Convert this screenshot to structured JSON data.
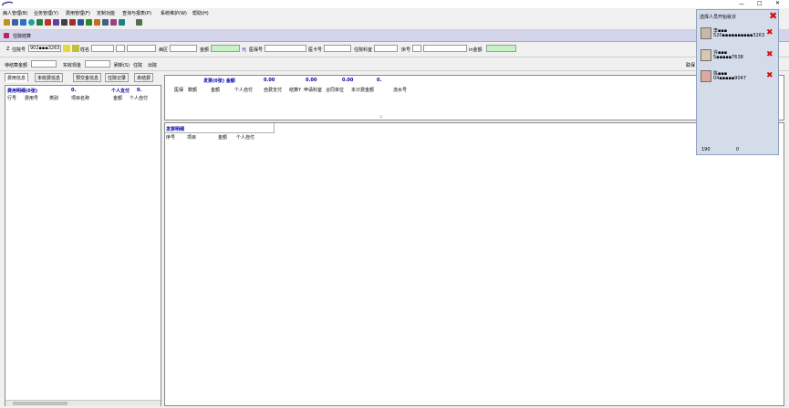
{
  "window": {
    "title": "住院结算",
    "controls": [
      "—",
      "□",
      "✕"
    ]
  },
  "menu": [
    "病人管理(B)",
    "业务管理(Y)",
    "费用管理(F)",
    "定制功能",
    "查询与报表(P)",
    "系统维护(W)",
    "帮助(H)"
  ],
  "form": {
    "admission_no_label": "住院号",
    "admission_no_value": "902▪▪▪3263",
    "name_label": "姓名",
    "bed_label": "病区",
    "amount_label": "金额",
    "unit_label": "元",
    "medical_no_label": "医保号",
    "card_no_label": "医卡号",
    "dept_label": "住院科室",
    "bed_no_label": "床号",
    "in_amount_label": "in金额",
    "pay_label": "待结算金额",
    "actual_label": "实收现金",
    "refresh_button": "刷新(S)",
    "settle_button": "住院",
    "exit_button": "出院"
  },
  "tabs": [
    "费用信息",
    "未收费信息",
    "预交金信息",
    "住院记录",
    "未结费"
  ],
  "left_panel": {
    "title": "费用明细(0张)",
    "title_value": "0.",
    "personal_label": "个人支付",
    "personal_value": "0.",
    "columns": [
      "行号",
      "费用号",
      "类别",
      "项目名称",
      "金额",
      "个人自付"
    ]
  },
  "summary": {
    "title": "发票(0张)  金额",
    "values": [
      "0.00",
      "0.00",
      "0.00",
      "0."
    ],
    "columns": [
      "医保",
      "数额",
      "金额",
      "个人自付",
      "自费支付",
      "结算Y",
      "申请科室",
      "合同单位",
      "本计费金额",
      "流水号"
    ]
  },
  "invoice_panel": {
    "title": "发票明细",
    "columns": [
      "序号",
      "项目",
      "金额",
      "个人自付"
    ]
  },
  "right_cut_label": "联保",
  "floating_panel": {
    "title": "选择人员开始就诊",
    "people": [
      {
        "name": "李▪▪▪",
        "id": "520▪▪▪▪▪▪▪▪▪▪3263"
      },
      {
        "name": "许▪▪▪",
        "id": "5▪▪▪▪▪7638"
      },
      {
        "name": "陈▪▪▪",
        "id": "04▪▪▪▪▪9047"
      }
    ],
    "footer_left": "190",
    "footer_right": "0"
  }
}
